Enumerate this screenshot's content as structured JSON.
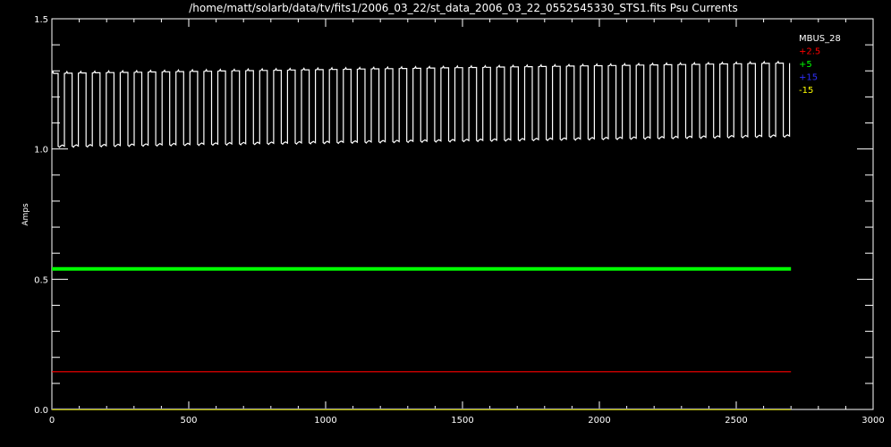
{
  "chart_data": {
    "type": "line",
    "title": "/home/matt/solarb/data/tv/fits1/2006_03_22/st_data_2006_03_22_0552545330_STS1.fits Psu Currents",
    "xlabel": "",
    "ylabel": "Amps",
    "xlim": [
      0,
      3000
    ],
    "ylim": [
      0,
      1.5
    ],
    "xticks": [
      0,
      500,
      1000,
      1500,
      2000,
      2500,
      3000
    ],
    "xtick_labels": [
      "0",
      "500",
      "1000",
      "1500",
      "2000",
      "2500",
      "3000"
    ],
    "yticks": [
      0.0,
      0.5,
      1.0,
      1.5
    ],
    "ytick_labels": [
      "0.0",
      "0.5",
      "1.0",
      "1.5"
    ],
    "legend_position": "top-right",
    "grid": false,
    "series": [
      {
        "name": "MBUS_28",
        "color": "#ffffff",
        "kind": "square_wave",
        "x_range": [
          0,
          2700
        ],
        "cycles": 53,
        "low": [
          1.01,
          1.05
        ],
        "high": [
          1.29,
          1.33
        ]
      },
      {
        "name": "+2.5",
        "color": "#ff0000",
        "kind": "flat",
        "x_range": [
          0,
          2700
        ],
        "value": 0.145
      },
      {
        "name": "+5",
        "color": "#00ff00",
        "kind": "flat",
        "x_range": [
          0,
          2700
        ],
        "value": 0.54
      },
      {
        "name": "+15",
        "color": "#3030ff",
        "kind": "flat",
        "x_range": [
          0,
          2700
        ],
        "value": 0.002
      },
      {
        "name": "-15",
        "color": "#ffff00",
        "kind": "flat",
        "x_range": [
          0,
          2700
        ],
        "value": 0.0
      }
    ]
  }
}
